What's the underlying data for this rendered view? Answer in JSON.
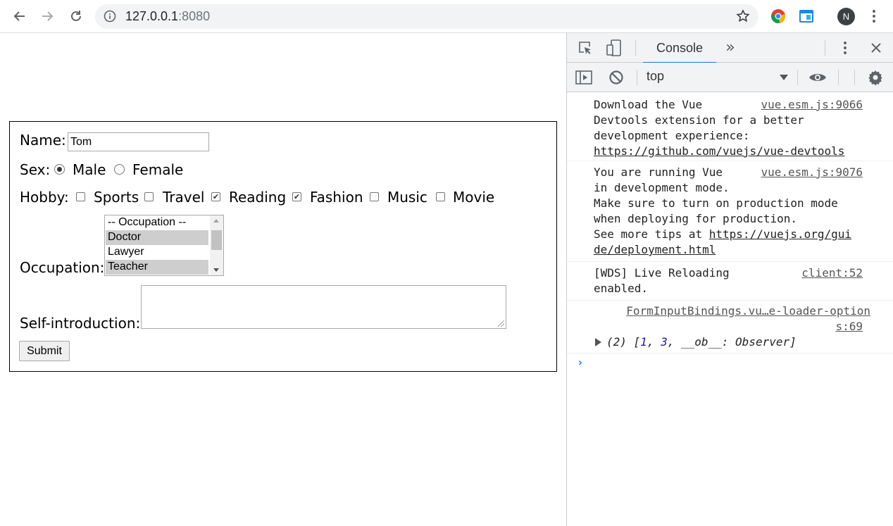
{
  "browser": {
    "url_host": "127.0.0.1",
    "url_port": ":8080",
    "avatar_letter": "N"
  },
  "form": {
    "name_label": "Name:",
    "name_value": "Tom",
    "sex_label": "Sex:",
    "sex_options": [
      {
        "label": "Male",
        "checked": true
      },
      {
        "label": "Female",
        "checked": false
      }
    ],
    "hobby_label": "Hobby:",
    "hobbies": [
      {
        "label": "Sports",
        "checked": false
      },
      {
        "label": "Travel",
        "checked": false
      },
      {
        "label": "Reading",
        "checked": true
      },
      {
        "label": "Fashion",
        "checked": true
      },
      {
        "label": "Music",
        "checked": false
      },
      {
        "label": "Movie",
        "checked": false
      }
    ],
    "occupation_label": "Occupation:",
    "occupations": [
      {
        "label": "-- Occupation --",
        "selected": false
      },
      {
        "label": "Doctor",
        "selected": true
      },
      {
        "label": "Lawyer",
        "selected": false
      },
      {
        "label": "Teacher",
        "selected": true
      }
    ],
    "intro_label": "Self-introduction:",
    "intro_value": "",
    "submit_label": "Submit"
  },
  "devtools": {
    "tab_label": "Console",
    "more_tabs": "»",
    "context": "top",
    "messages": [
      {
        "lines": [
          "Download the Vue",
          "Devtools extension for a better",
          "development experience:"
        ],
        "link": "https://github.com/vuejs/vue-devtools",
        "source": "vue.esm.js:9066"
      },
      {
        "lines": [
          "You are running Vue",
          "in development mode.",
          "Make sure to turn on production mode",
          "when deploying for production.",
          "See more tips at "
        ],
        "link_a": "https://vuejs.org/gui",
        "link_b": "de/deployment.html",
        "source": "vue.esm.js:9076"
      },
      {
        "lines": [
          "[WDS] Live Reloading",
          "enabled."
        ],
        "source": "client:52"
      },
      {
        "source_a": "FormInputBindings.vu…e-loader-option",
        "source_b": "s:69",
        "log_prefix": "(2) [",
        "log_n1": "1",
        "log_sep": ", ",
        "log_n2": "3",
        "log_suffix": ", __ob__: Observer]"
      }
    ],
    "prompt": "›"
  }
}
